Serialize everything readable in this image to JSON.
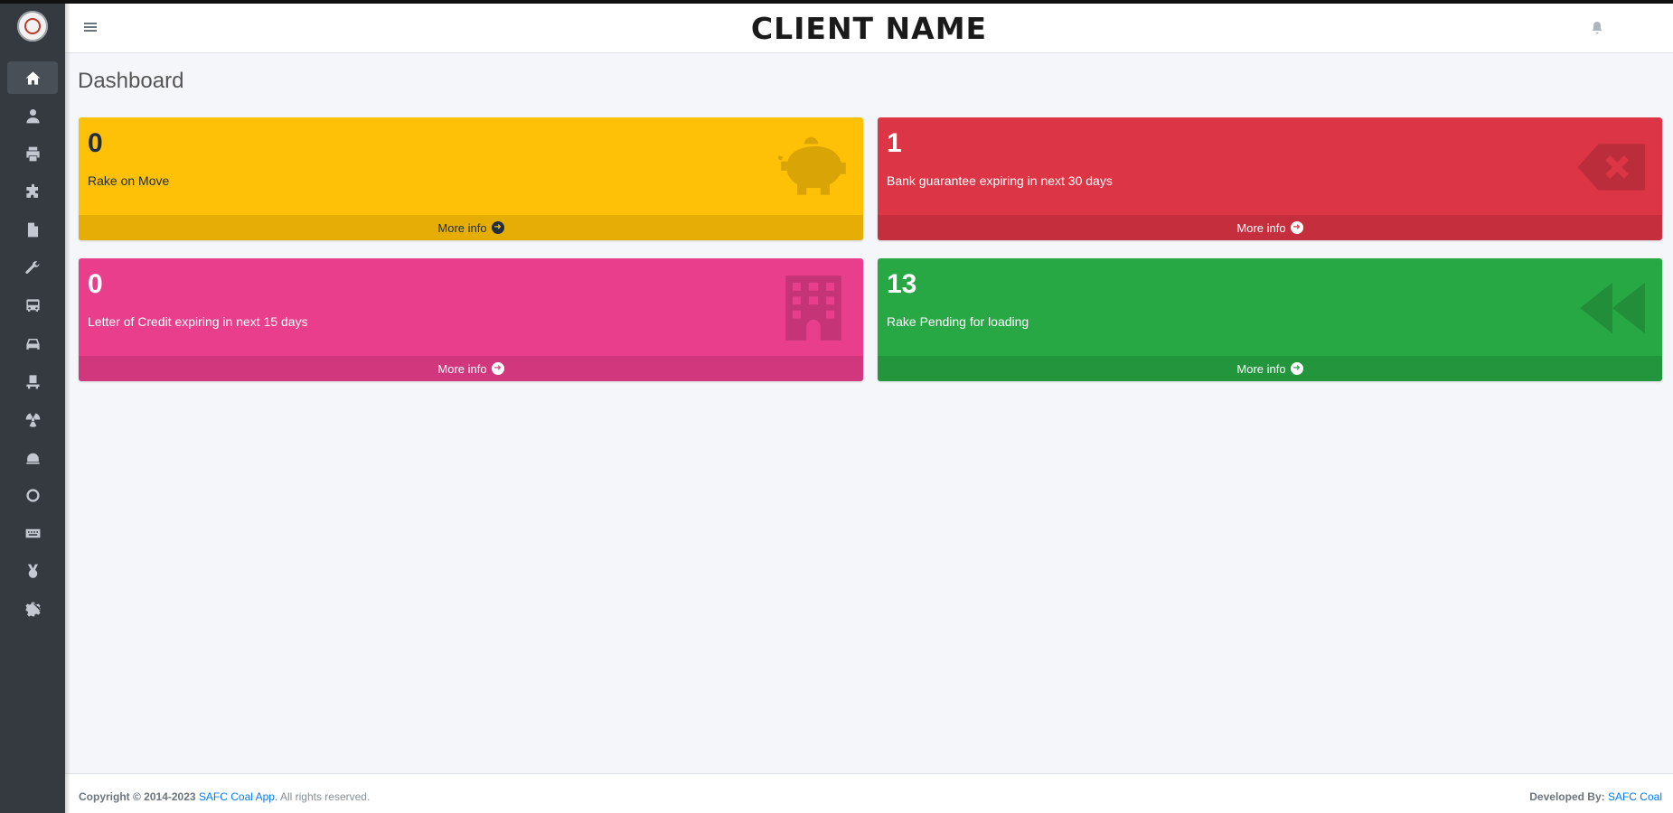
{
  "header": {
    "client_name": "CLIENT NAME"
  },
  "page": {
    "title": "Dashboard"
  },
  "sidebar": {
    "items": [
      {
        "icon": "home-icon",
        "active": true
      },
      {
        "icon": "user-icon"
      },
      {
        "icon": "printer-icon"
      },
      {
        "icon": "puzzle-icon"
      },
      {
        "icon": "file-icon"
      },
      {
        "icon": "wrench-icon"
      },
      {
        "icon": "bus-icon"
      },
      {
        "icon": "car-icon"
      },
      {
        "icon": "desk-icon"
      },
      {
        "icon": "radiation-icon"
      },
      {
        "icon": "train-icon"
      },
      {
        "icon": "circle-icon"
      },
      {
        "icon": "keyboard-icon"
      },
      {
        "icon": "medal-icon"
      },
      {
        "icon": "settings-icon"
      }
    ]
  },
  "cards": [
    {
      "count": "0",
      "label": "Rake on Move",
      "more": "More info",
      "color": "#ffc107",
      "icon": "piggy-bank-icon"
    },
    {
      "count": "1",
      "label": "Bank guarantee expiring in next 30 days",
      "more": "More info",
      "color": "#dc3545",
      "icon": "backspace-icon"
    },
    {
      "count": "0",
      "label": "Letter of Credit expiring in next 15 days",
      "more": "More info",
      "color": "#e83e8c",
      "icon": "building-icon"
    },
    {
      "count": "13",
      "label": "Rake Pending for loading",
      "more": "More info",
      "color": "#28a745",
      "icon": "backward-icon"
    }
  ],
  "footer": {
    "copyright_prefix": "Copyright © 2014-2023 ",
    "app_link": "SAFC Coal App.",
    "rights": " All rights reserved.",
    "developed_by_label": "Developed By: ",
    "developer_link": "SAFC Coal"
  }
}
